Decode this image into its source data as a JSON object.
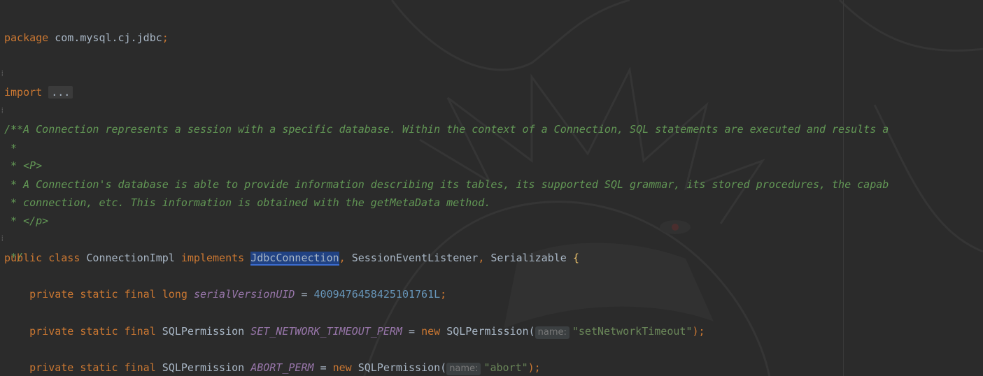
{
  "lines": {
    "l1": {
      "kw": "package",
      "pkg": "com.mysql.cj.jdbc",
      "semi": ";"
    },
    "l2": {
      "kw": "import",
      "fold": "..."
    },
    "l3": {
      "text": "/**"
    },
    "l4": {
      "text": " * A Connection represents a session with a specific database. Within the context of a Connection, SQL statements are executed and results a"
    },
    "l5": {
      "text": " *"
    },
    "l6": {
      "star": " * ",
      "tag": "<P>"
    },
    "l7": {
      "text": " * A Connection's database is able to provide information describing its tables, its supported SQL grammar, its stored procedures, the capab"
    },
    "l8": {
      "text": " * connection, etc. This information is obtained with the getMetaData method."
    },
    "l9": {
      "star": " * ",
      "tag": "</p>"
    },
    "l10": {
      "text": " */"
    },
    "l11": {
      "kw1": "public",
      "kw2": "class",
      "name": "ConnectionImpl",
      "kw3": "implements",
      "iface1": "JdbcConnection",
      "comma1": ",",
      "iface2": "SessionEventListener",
      "comma2": ",",
      "iface3": "Serializable",
      "brace": "{"
    },
    "l12": {
      "kw1": "private",
      "kw2": "static",
      "kw3": "final",
      "type": "long",
      "field": "serialVersionUID",
      "eq": "=",
      "num": "4009476458425101761L",
      "semi": ";"
    },
    "l13": {
      "kw1": "private",
      "kw2": "static",
      "kw3": "final",
      "type": "SQLPermission",
      "field": "SET_NETWORK_TIMEOUT_PERM",
      "eq": "=",
      "kwnew": "new",
      "ctor": "SQLPermission(",
      "hint": "name:",
      "str": "\"setNetworkTimeout\"",
      "end": ");"
    },
    "l14": {
      "kw1": "private",
      "kw2": "static",
      "kw3": "final",
      "type": "SQLPermission",
      "field": "ABORT_PERM",
      "eq": "=",
      "kwnew": "new",
      "ctor": "SQLPermission(",
      "hint": "name:",
      "str": "\"abort\"",
      "end": ");"
    }
  },
  "colors": {
    "background": "#2b2b2b",
    "keyword": "#cc7832",
    "plain": "#a9b7c6",
    "comment": "#629755",
    "field": "#9876aa",
    "number": "#6897bb",
    "string": "#6a8759",
    "selection": "#214283"
  }
}
